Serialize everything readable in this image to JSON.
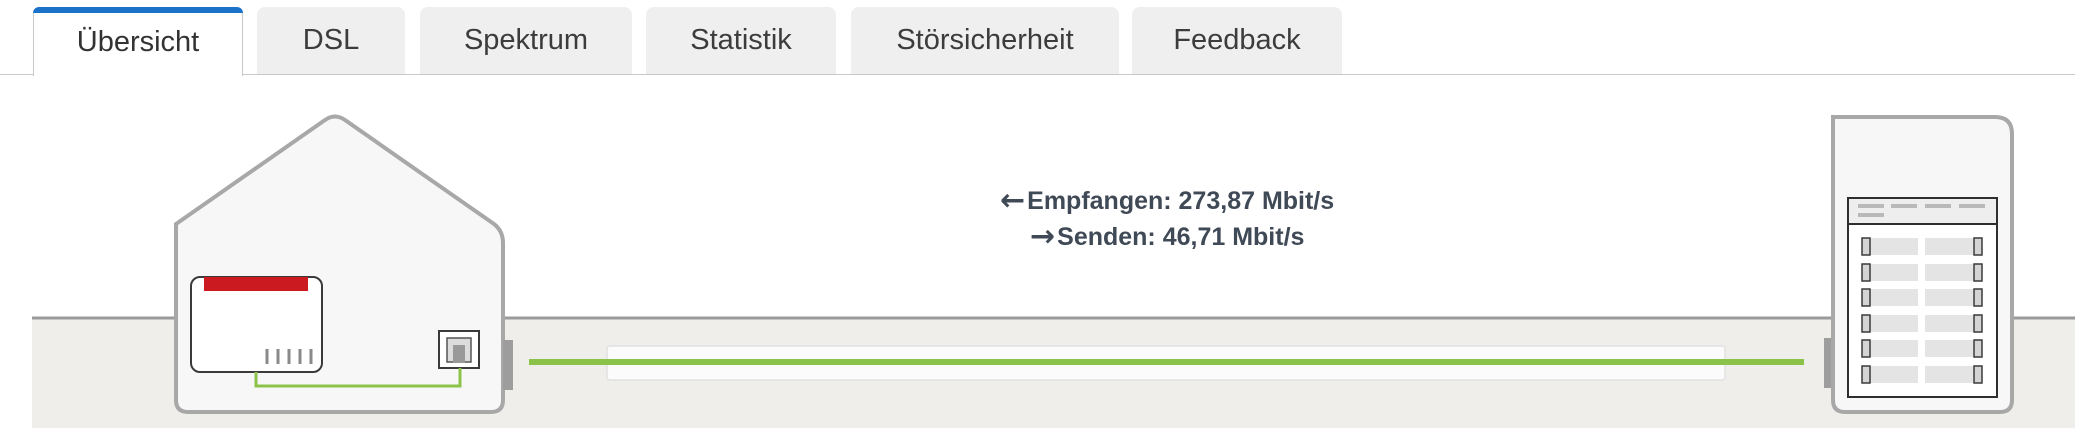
{
  "tabs": [
    {
      "label": "Übersicht",
      "active": true
    },
    {
      "label": "DSL",
      "active": false
    },
    {
      "label": "Spektrum",
      "active": false
    },
    {
      "label": "Statistik",
      "active": false
    },
    {
      "label": "Störsicherheit",
      "active": false
    },
    {
      "label": "Feedback",
      "active": false
    }
  ],
  "connection": {
    "receive_label": "Empfangen: 273,87 Mbit/s",
    "send_label": "Senden: 46,71 Mbit/s",
    "line_status_color": "#8bc34a",
    "router_accent_color": "#cc1b20"
  }
}
